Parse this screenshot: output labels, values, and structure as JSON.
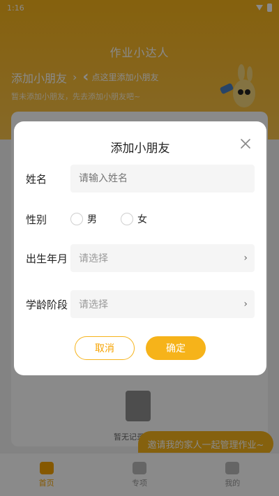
{
  "status": {
    "time": "1:16"
  },
  "background": {
    "app_title": "作业小达人",
    "add_child_title": "添加小朋友",
    "tip_text": "点这里添加小朋友",
    "sub_desc": "暂未添加小朋友，先去添加小朋友吧~",
    "empty_text": "暂无记录",
    "invite_text": "邀请我的家人一起管理作业~",
    "tabs": [
      {
        "label": "首页"
      },
      {
        "label": "专项"
      },
      {
        "label": "我的"
      }
    ]
  },
  "modal": {
    "title": "添加小朋友",
    "name": {
      "label": "姓名",
      "placeholder": "请输入姓名"
    },
    "gender": {
      "label": "性别",
      "options": [
        "男",
        "女"
      ]
    },
    "birth": {
      "label": "出生年月",
      "placeholder": "请选择"
    },
    "stage": {
      "label": "学龄阶段",
      "placeholder": "请选择"
    },
    "cancel": "取消",
    "confirm": "确定"
  },
  "colors": {
    "accent": "#f6b31a"
  }
}
